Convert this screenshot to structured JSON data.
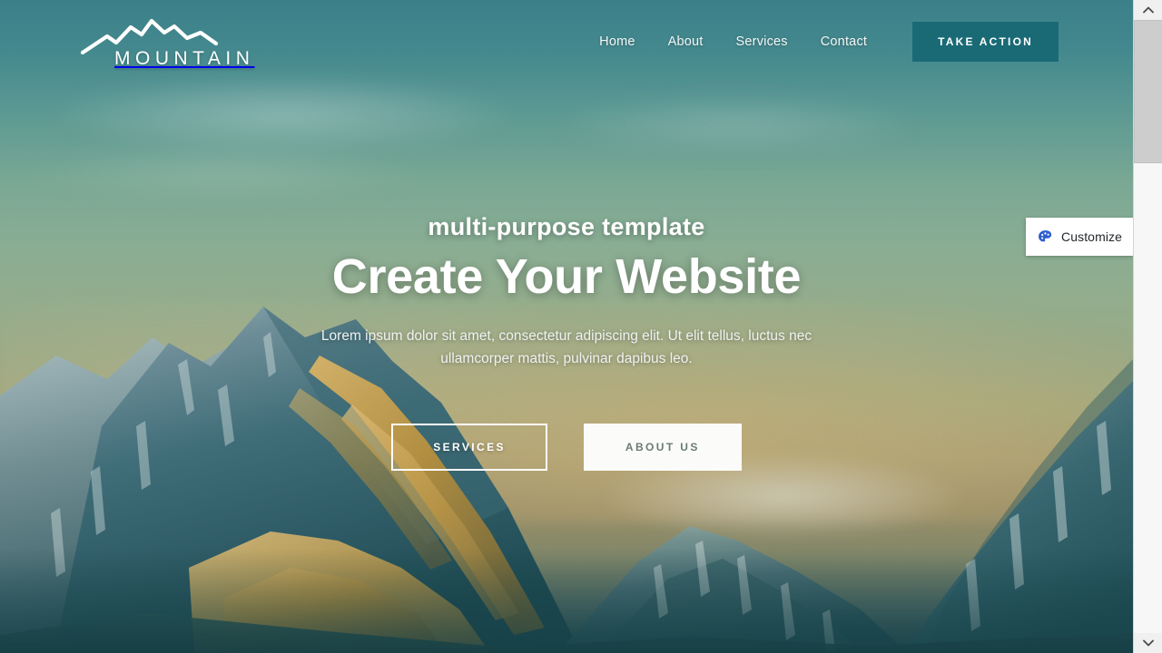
{
  "site": {
    "brand_name": "MOUNTAIN",
    "logo_icon": "mountain-range-icon"
  },
  "nav": {
    "links": [
      {
        "label": "Home"
      },
      {
        "label": "About"
      },
      {
        "label": "Services"
      },
      {
        "label": "Contact"
      }
    ],
    "cta_label": "TAKE ACTION"
  },
  "hero": {
    "eyebrow": "multi-purpose template",
    "title": "Create Your Website",
    "description": "Lorem ipsum dolor sit amet, consectetur adipiscing elit. Ut elit tellus, luctus nec ullamcorper mattis, pulvinar dapibus leo.",
    "primary_button": "SERVICES",
    "secondary_button": "ABOUT US"
  },
  "customize": {
    "label": "Customize",
    "icon": "paint-palette-icon"
  },
  "scrollbar": {
    "up_icon": "chevron-up-icon",
    "down_icon": "chevron-down-icon"
  },
  "colors": {
    "accent_teal": "#1a6a76",
    "sky_top": "#3b8089",
    "sky_mid": "#8aad93",
    "sky_warm": "#a89f72",
    "mountain_dark": "#24515a",
    "mountain_rock": "#b9954f",
    "panel_white": "#ffffff",
    "customize_icon_blue": "#2f5fd0"
  }
}
